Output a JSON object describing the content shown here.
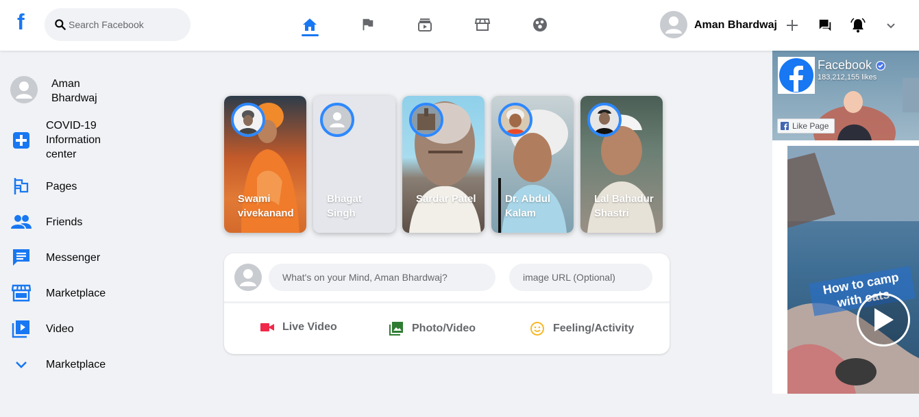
{
  "header": {
    "search_placeholder": "Search Facebook",
    "user_name": "Aman Bhardwaj",
    "logo_letter": "f",
    "nav_icons": [
      "home-icon",
      "flag-icon",
      "watch-icon",
      "marketplace-icon",
      "groups-icon"
    ],
    "right_icons": [
      "plus-icon",
      "messenger-icon",
      "notification-bell-icon",
      "chevron-down-icon"
    ]
  },
  "sidebar": {
    "user_name": "Aman Bhardwaj",
    "items": [
      {
        "label": "COVID-19 Information center",
        "icon": "covid-cross-icon"
      },
      {
        "label": "Pages",
        "icon": "pages-flag-icon"
      },
      {
        "label": "Friends",
        "icon": "friends-icon"
      },
      {
        "label": "Messenger",
        "icon": "messenger-chat-icon"
      },
      {
        "label": "Marketplace",
        "icon": "marketplace-store-icon"
      },
      {
        "label": "Video",
        "icon": "video-play-icon"
      },
      {
        "label": "Marketplace",
        "icon": "chevron-down-icon"
      }
    ]
  },
  "stories": [
    {
      "name": "Swami vivekanand"
    },
    {
      "name": "Bhagat Singh"
    },
    {
      "name": "Sardar Patel"
    },
    {
      "name": "Dr. Abdul Kalam"
    },
    {
      "name": "Lal Bahadur Shastri"
    }
  ],
  "composer": {
    "post_placeholder": "What's on your Mind, Aman Bhardwaj?",
    "image_placeholder": "image URL (Optional)",
    "options": [
      {
        "label": "Live Video",
        "icon": "live-video-icon",
        "color": "#f02849"
      },
      {
        "label": "Photo/Video",
        "icon": "photo-icon",
        "color": "#45bd62"
      },
      {
        "label": "Feeling/Activity",
        "icon": "smile-icon",
        "color": "#f7b928"
      }
    ]
  },
  "right_panel": {
    "page_name": "Facebook",
    "likes": "183,212,155 likes",
    "like_button": "Like Page",
    "video_caption": "How to camp with cats"
  },
  "colors": {
    "brand": "#1877f2",
    "background": "#f0f2f5",
    "story_ring": "#2d88ff"
  }
}
